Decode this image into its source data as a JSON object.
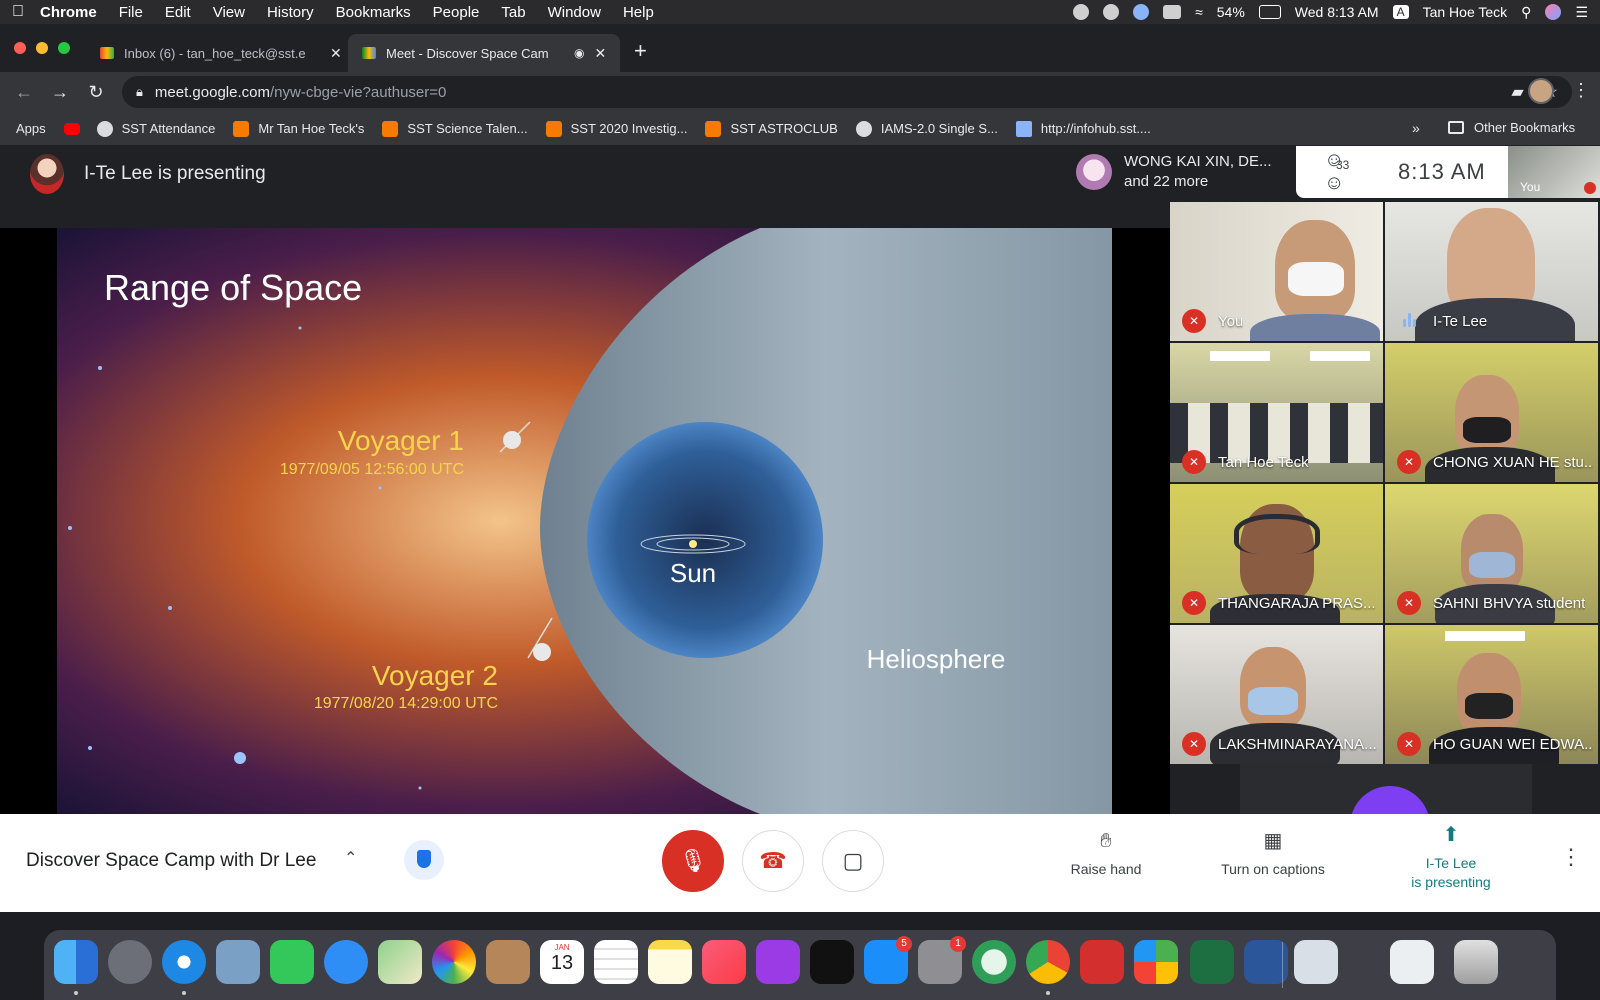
{
  "menubar": {
    "app": "Chrome",
    "menus": [
      "File",
      "Edit",
      "View",
      "History",
      "Bookmarks",
      "People",
      "Tab",
      "Window",
      "Help"
    ],
    "battery": "54%",
    "datetime": "Wed 8:13 AM",
    "input_source": "A",
    "user": "Tan Hoe Teck"
  },
  "tabs": [
    {
      "title": "Inbox (6) - tan_hoe_teck@sst.e",
      "active": false
    },
    {
      "title": "Meet - Discover Space Cam",
      "active": true
    }
  ],
  "address": {
    "host": "meet.google.com",
    "path": "/nyw-cbge-vie?authuser=0"
  },
  "bookmarks": {
    "items": [
      "Apps",
      "SST Attendance",
      "Mr Tan Hoe Teck's",
      "SST Science Talen...",
      "SST 2020 Investig...",
      "SST ASTROCLUB",
      "IAMS-2.0 Single S...",
      "http://infohub.sst...."
    ],
    "other": "Other Bookmarks",
    "overflow": "»"
  },
  "meet": {
    "presenting_text": "I-Te Lee is presenting",
    "participants_chip": {
      "line1": "WONG KAI XIN, DE...",
      "line2": "and 22 more"
    },
    "people_count": "33",
    "time": "8:13 AM",
    "self_label": "You",
    "slide": {
      "title": "Range of Space",
      "voyager1": "Voyager 1",
      "voyager1_date": "1977/09/05 12:56:00 UTC",
      "voyager2": "Voyager 2",
      "voyager2_date": "1977/08/20 14:29:00 UTC",
      "sun": "Sun",
      "heliosphere": "Heliosphere"
    },
    "tiles": [
      {
        "name": "You",
        "mic": "muted"
      },
      {
        "name": "I-Te Lee",
        "mic": "speaking"
      },
      {
        "name": "Tan Hoe Teck",
        "mic": "muted"
      },
      {
        "name": "CHONG XUAN HE stu...",
        "mic": "muted"
      },
      {
        "name": "THANGARAJA PRAS...",
        "mic": "muted"
      },
      {
        "name": "SAHNI BHVYA student",
        "mic": "muted"
      },
      {
        "name": "LAKSHMINARAYANA...",
        "mic": "muted"
      },
      {
        "name": "HO GUAN WEI EDWA...",
        "mic": "muted"
      }
    ]
  },
  "controls": {
    "meeting_title": "Discover Space Camp with Dr Lee",
    "raise_hand": "Raise hand",
    "captions": "Turn on captions",
    "presenting_line1": "I-Te Lee",
    "presenting_line2": "is presenting"
  },
  "dock": {
    "calendar_month": "JAN",
    "calendar_day": "13",
    "app_store_badge": "5",
    "settings_badge": "1"
  },
  "colors": {
    "meet_bg": "#202124",
    "danger": "#d93025",
    "accent": "#1a73e8",
    "slide_yellow": "#f7d44c"
  }
}
